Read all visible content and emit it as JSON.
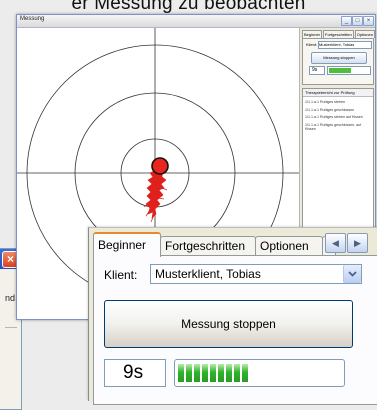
{
  "caption": "er Messung zu beobachten",
  "background_window": {
    "text": "nd"
  },
  "main_window": {
    "title": "Messung",
    "controls": {
      "minimize": "_",
      "maximize": "□",
      "close": "×"
    }
  },
  "mini_panel": {
    "tabs": [
      "Beginner",
      "Fortgeschritten",
      "Optionen"
    ],
    "client_label": "Klient:",
    "client_value": "Musterklient, Tobias",
    "button": "Messung stoppen",
    "time": "9s",
    "list_header": "Therapiebericht zur Prüfung",
    "entries": [
      "1/1.1.a.1 Ruhiges stehen",
      "1/1.1.a.1 Ruhiges geschlossen",
      "1/1.1.a.1 Ruhiges stehen auf Kissen",
      "1/1.1.a.1 Ruhiges geschlossen, auf Kissen"
    ]
  },
  "panel": {
    "tabs": {
      "beginner": "Beginner",
      "advanced": "Fortgeschritten",
      "options": "Optionen",
      "next": "N"
    },
    "scroll": {
      "left": "◀",
      "right": "▶"
    },
    "client_label": "Klient:",
    "client_value": "Musterklient, Tobias",
    "stop_button": "Messung stoppen",
    "time": "9s",
    "progress_blocks": 9
  },
  "colors": {
    "trace": "#e0201c",
    "marker": "#e8261f",
    "progress": "#2fb32a",
    "active_tab_accent": "#e68b2c"
  }
}
